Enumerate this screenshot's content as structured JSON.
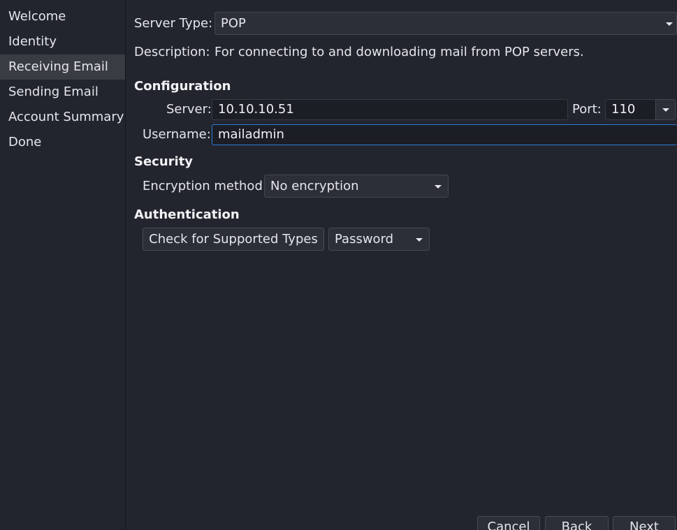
{
  "sidebar": {
    "items": [
      {
        "label": "Welcome",
        "selected": false
      },
      {
        "label": "Identity",
        "selected": false
      },
      {
        "label": "Receiving Email",
        "selected": true
      },
      {
        "label": "Sending Email",
        "selected": false
      },
      {
        "label": "Account Summary",
        "selected": false
      },
      {
        "label": "Done",
        "selected": false
      }
    ]
  },
  "server_type": {
    "label": "Server Type:",
    "value": "POP"
  },
  "description": {
    "label": "Description:",
    "text": "For connecting to and downloading mail from POP servers."
  },
  "configuration": {
    "heading": "Configuration",
    "server_label": "Server:",
    "server_value": "10.10.10.51",
    "port_label": "Port:",
    "port_value": "110",
    "username_label": "Username:",
    "username_value": "mailadmin"
  },
  "security": {
    "heading": "Security",
    "encryption_label": "Encryption method:",
    "encryption_value": "No encryption"
  },
  "authentication": {
    "heading": "Authentication",
    "check_button": "Check for Supported Types",
    "method_value": "Password"
  },
  "footer": {
    "cancel": "Cancel",
    "back": "Back",
    "next": "Next"
  },
  "colors": {
    "background": "#23252e",
    "selected_item": "#3a3c44",
    "focus_border": "#2b7bd6"
  }
}
